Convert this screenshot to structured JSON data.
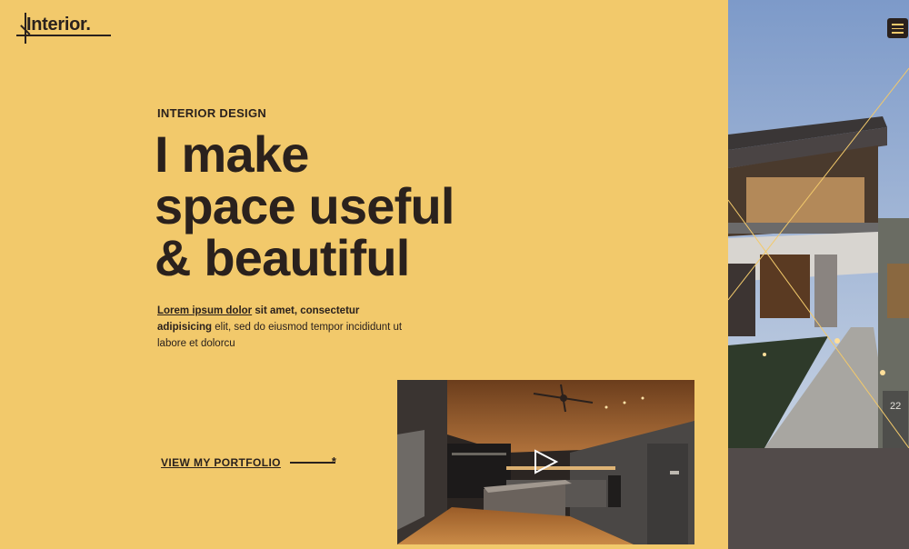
{
  "brand": {
    "logo_text": "Interior."
  },
  "hero": {
    "eyebrow": "INTERIOR DESIGN",
    "headline_lines": [
      "I make",
      "space useful",
      "& beautiful"
    ],
    "description": {
      "link_text": "Lorem ipsum dolor",
      "bold_text_1": "sit amet, consectetur",
      "bold_text_2": "adipisicing",
      "body_1": "elit, sed do eiusmod tempor incididunt ut",
      "body_2": "labore et dolorcu"
    },
    "cta_label": "VIEW MY PORTFOLIO"
  },
  "icons": {
    "menu": "hamburger-menu-icon",
    "play": "play-icon",
    "arrow": "arrow-right-icon"
  },
  "side_photo": {
    "house_number": "22"
  },
  "colors": {
    "background": "#f2c96b",
    "text": "#2a211d",
    "dark_panel": "#524b4a"
  }
}
